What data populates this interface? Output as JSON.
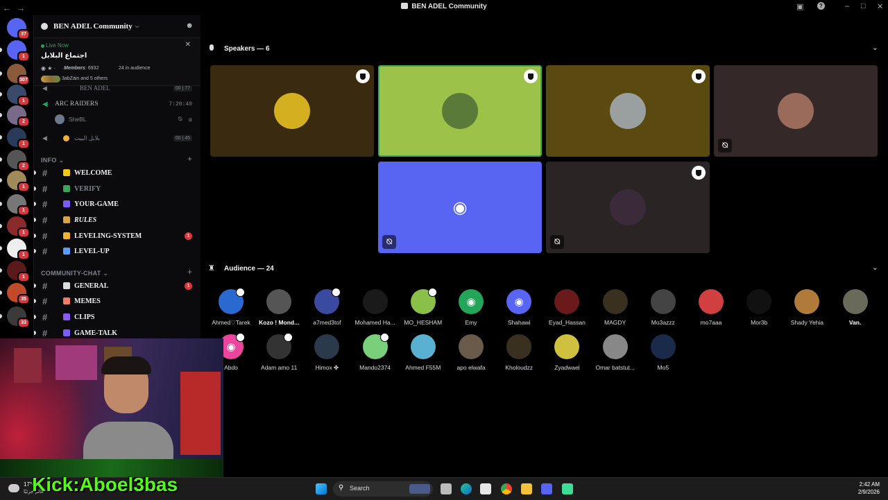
{
  "window": {
    "title": "BEN ADEL Community"
  },
  "rail": {
    "servers": [
      {
        "name": "home",
        "badge": "37",
        "color": "#5865f2"
      },
      {
        "name": "discord",
        "badge": "1",
        "color": "#5865f2"
      },
      {
        "name": "s3",
        "badge": "307",
        "color": "#8a5a3a"
      },
      {
        "name": "s4",
        "badge": "1",
        "color": "#3a4a6a"
      },
      {
        "name": "s5",
        "badge": "2",
        "color": "#7a6a8a"
      },
      {
        "name": "s6",
        "badge": "1",
        "color": "#2a3a5a"
      },
      {
        "name": "s7",
        "badge": "2",
        "color": "#555"
      },
      {
        "name": "s8",
        "badge": "1",
        "color": "#a08a5a"
      },
      {
        "name": "s9",
        "badge": "1",
        "color": "#777"
      },
      {
        "name": "s10",
        "badge": "1",
        "color": "#8a2a2a"
      },
      {
        "name": "s11",
        "badge": "1",
        "color": "#eee"
      },
      {
        "name": "s12",
        "badge": "1",
        "color": "#5a1a1a"
      },
      {
        "name": "s13",
        "badge": "35",
        "color": "#c04a2a"
      },
      {
        "name": "s14",
        "badge": "33",
        "color": "#3a3a3a"
      }
    ]
  },
  "sidebar": {
    "server_name": "BEN ADEL Community",
    "live": {
      "label": "Live Now",
      "title": "اجتماع البلابل",
      "members_label": "Members",
      "members_count": ": 6932",
      "audience": "24 in audience",
      "people": "3abZain and 5 others"
    },
    "voice": [
      {
        "name": "BEN ADEL",
        "counts": "00 | 77"
      },
      {
        "name": "ARC RAIDERS",
        "time": "7:20:40"
      },
      {
        "user": "SheBL"
      },
      {
        "name": "بلابل البيت",
        "counts": "00 | 45"
      }
    ],
    "categories": {
      "info": "INFO",
      "community": "COMMUNITY-CHAT"
    },
    "channels": [
      {
        "name": "WELCOME",
        "emo": "#f5c518",
        "dim": false,
        "badge": ""
      },
      {
        "name": "VERIFY",
        "emo": "#3ba55c",
        "dim": true,
        "badge": ""
      },
      {
        "name": "YOUR-GAME",
        "emo": "#7c5cff",
        "dim": false,
        "badge": ""
      },
      {
        "name": "RULES",
        "emo": "#d9a441",
        "dim": false,
        "badge": ""
      },
      {
        "name": "LEVELING-SYSTEM",
        "emo": "#f0b232",
        "dim": false,
        "badge": "1"
      },
      {
        "name": "LEVEL-UP",
        "emo": "#5b9cff",
        "dim": false,
        "badge": ""
      },
      {
        "name": "GENERAL",
        "emo": "#dbdee1",
        "dim": false,
        "badge": "1"
      },
      {
        "name": "MEMES",
        "emo": "#f47b67",
        "dim": false,
        "badge": ""
      },
      {
        "name": "CLIPS",
        "emo": "#8a5cf5",
        "dim": false,
        "badge": ""
      },
      {
        "name": "GAME-TALK",
        "emo": "#7c5cff",
        "dim": false,
        "badge": ""
      }
    ]
  },
  "main": {
    "speakers_title": "Speakers — 6",
    "audience_title": "Audience — 24",
    "speakers": [
      {
        "bg": "#3a2a10",
        "av": "#d4b020",
        "shield": true,
        "muted": false
      },
      {
        "bg": "#9cc24a",
        "av": "#5a7a3a",
        "shield": true,
        "muted": false
      },
      {
        "bg": "#5a4a10",
        "av": "#9aa0a0",
        "shield": true,
        "muted": false
      },
      {
        "bg": "#352828",
        "av": "#9a6a5a",
        "shield": false,
        "muted": true
      },
      {
        "bg": "#5865f2",
        "av": "discord",
        "shield": false,
        "muted": true
      },
      {
        "bg": "#2a2424",
        "av": "#3a2a3a",
        "shield": true,
        "muted": true
      }
    ],
    "audience": [
      {
        "name": "Ahmed♡Tarek",
        "av": "#2a6ad0",
        "bold": false,
        "shield": true
      },
      {
        "name": "Kozo ! Mond...",
        "av": "#555",
        "bold": true,
        "shield": false
      },
      {
        "name": "a7med3tof",
        "av": "#3a4aa0",
        "bold": false,
        "shield": true
      },
      {
        "name": "Mohamed Ha...",
        "av": "#1a1a1a",
        "bold": false,
        "shield": false
      },
      {
        "name": "MO_HESHAM",
        "av": "#8ac04a",
        "bold": false,
        "shield": true
      },
      {
        "name": "Emy",
        "av": "#23a55a",
        "bold": false,
        "shield": false,
        "discord": true
      },
      {
        "name": "Shahawi",
        "av": "#5865f2",
        "bold": false,
        "shield": false,
        "discord": true
      },
      {
        "name": "Eyad_Hassan",
        "av": "#6a1a1a",
        "bold": false,
        "shield": false
      },
      {
        "name": "MAGDY",
        "av": "#3a3020",
        "bold": false,
        "shield": false
      },
      {
        "name": "Mo3azzz",
        "av": "#444",
        "bold": false,
        "shield": false
      },
      {
        "name": "mo7aaa",
        "av": "#d04040",
        "bold": false,
        "shield": false
      },
      {
        "name": "Mor3b",
        "av": "#111",
        "bold": false,
        "shield": false
      },
      {
        "name": "Shady Yehia",
        "av": "#b07a3a",
        "bold": false,
        "shield": false
      },
      {
        "name": "Van.",
        "av": "#6a6a5a",
        "bold": true,
        "shield": false
      },
      {
        "name": "Abdo",
        "av": "#eb459e",
        "bold": false,
        "shield": true,
        "discord": true
      },
      {
        "name": "Adam amo 11",
        "av": "#333",
        "bold": false,
        "shield": true
      },
      {
        "name": "Himox ✤",
        "av": "#2a3a4a",
        "bold": false,
        "shield": false
      },
      {
        "name": "Mando2374",
        "av": "#7ad07a",
        "bold": false,
        "shield": true
      },
      {
        "name": "Ahmed F55M",
        "av": "#5ab0d0",
        "bold": false,
        "shield": false
      },
      {
        "name": "apo elwafa",
        "av": "#6a5a4a",
        "bold": false,
        "shield": false
      },
      {
        "name": "Kholoudzz",
        "av": "#3a3020",
        "bold": false,
        "shield": false
      },
      {
        "name": "Zyadwael",
        "av": "#d0c040",
        "bold": false,
        "shield": false
      },
      {
        "name": "Omar batstut...",
        "av": "#888",
        "bold": false,
        "shield": false
      },
      {
        "name": "Mo5",
        "av": "#1a2a4a",
        "bold": false,
        "shield": false
      }
    ]
  },
  "overlay": {
    "kick": "Kick:Aboel3bas"
  },
  "taskbar": {
    "weather_temp": "17°C",
    "weather_desc": "غائم جزئيًا",
    "search_placeholder": "Search",
    "time": "2:42 AM",
    "date": "2/9/2026"
  }
}
